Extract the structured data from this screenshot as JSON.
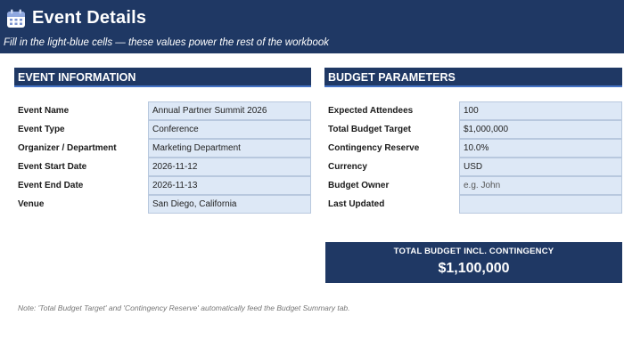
{
  "header": {
    "title": "Event Details",
    "subtitle": "Fill in the light-blue cells — these values power the rest of the workbook",
    "icon": "calendar-icon"
  },
  "event_information": {
    "heading": "EVENT INFORMATION",
    "rows": [
      {
        "label": "Event Name",
        "value": "Annual Partner Summit 2026"
      },
      {
        "label": "Event Type",
        "value": "Conference"
      },
      {
        "label": "Organizer / Department",
        "value": "Marketing Department"
      },
      {
        "label": "Event Start Date",
        "value": "2026-11-12"
      },
      {
        "label": "Event End Date",
        "value": "2026-11-13"
      },
      {
        "label": "Venue",
        "value": "San Diego, California"
      }
    ]
  },
  "budget_parameters": {
    "heading": "BUDGET PARAMETERS",
    "rows": [
      {
        "label": "Expected Attendees",
        "value": "100"
      },
      {
        "label": "Total Budget Target",
        "value": "$1,000,000"
      },
      {
        "label": "Contingency Reserve",
        "value": "10.0%"
      },
      {
        "label": "Currency",
        "value": "USD"
      },
      {
        "label": "Budget Owner",
        "value": "e.g. John"
      },
      {
        "label": "Last Updated",
        "value": ""
      }
    ]
  },
  "total_budget": {
    "label": "TOTAL BUDGET INCL. CONTINGENCY",
    "value": "$1,100,000"
  },
  "note": "Note: 'Total Budget Target' and 'Contingency Reserve' automatically feed the Budget Summary tab.",
  "colors": {
    "header_bg": "#1f3864",
    "input_cell_bg": "#dde8f6",
    "accent": "#4472c4"
  }
}
